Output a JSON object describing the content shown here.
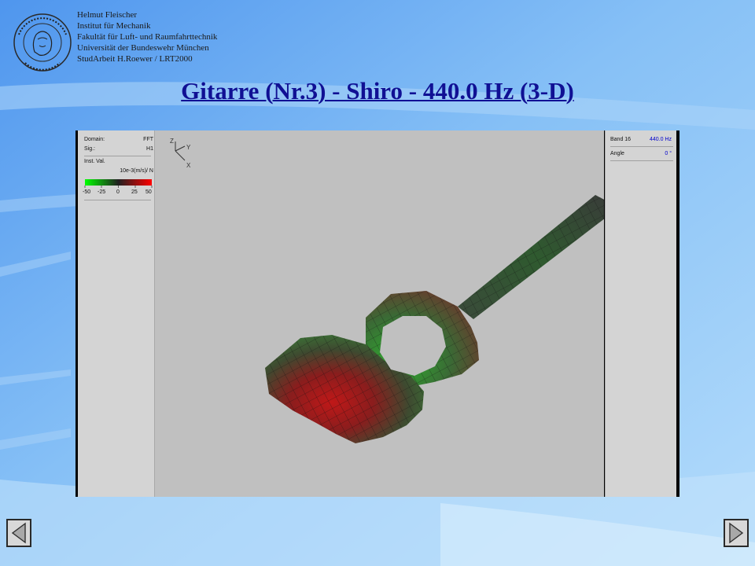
{
  "header": {
    "lines": [
      "Helmut Fleischer",
      "Institut für Mechanik",
      "Fakultät für Luft- und Raumfahrttechnik",
      "Universität der Bundeswehr München",
      "StudArbeit H.Roewer / LRT2000"
    ]
  },
  "seal": {
    "icon": "university-seal-icon",
    "text_top": "UNIVERSITÄT DER BUNDESWEHR",
    "text_bottom": "MÜNCHEN"
  },
  "title": "Gitarre (Nr.3) - Shiro - 440.0 Hz (3-D)",
  "left_panel": {
    "domain_label": "Domain:",
    "domain_value": "FFT",
    "sig_label": "Sig.:",
    "sig_value": "H1",
    "inst_label": "Inst. Val.",
    "unit": "10e-3(m/s)/ N",
    "scale_ticks": [
      "-50",
      "-25",
      "0",
      "25",
      "50"
    ]
  },
  "right_panel": {
    "band_label": "Band 16",
    "band_value": "440.0 Hz",
    "angle_label": "Angle",
    "angle_value": "0 °"
  },
  "axes": {
    "z": "Z",
    "y": "Y",
    "x": "X"
  },
  "colors": {
    "title": "#101094",
    "value_blue": "#0000cc",
    "mesh_green": "#2f9a2f",
    "mesh_red": "#a01818",
    "background_blue": "#7fb8f4"
  },
  "nav": {
    "prev_icon": "previous-slide-icon",
    "next_icon": "next-slide-icon"
  }
}
